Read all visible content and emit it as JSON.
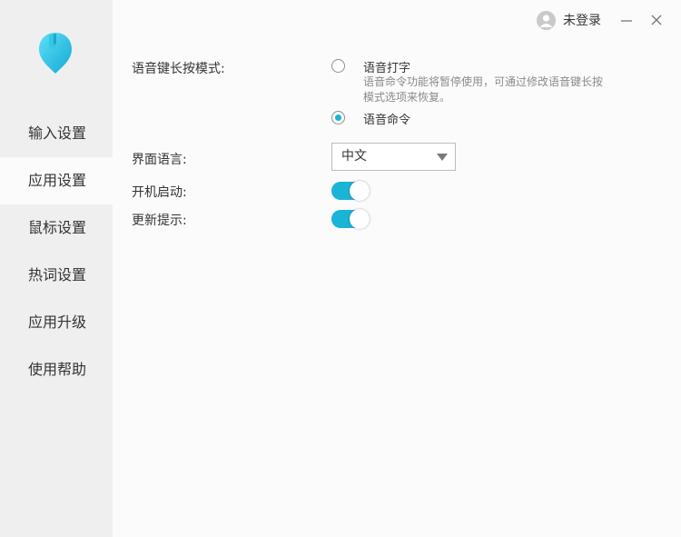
{
  "colors": {
    "accent": "#1ab4d6",
    "sidebar_bg": "#efefef",
    "content_bg": "#fbfbfb"
  },
  "titlebar": {
    "user_label": "未登录",
    "minimize_icon": "minimize-icon",
    "close_icon": "close-icon"
  },
  "sidebar": {
    "items": [
      {
        "label": "输入设置",
        "active": false
      },
      {
        "label": "应用设置",
        "active": true
      },
      {
        "label": "鼠标设置",
        "active": false
      },
      {
        "label": "热词设置",
        "active": false
      },
      {
        "label": "应用升级",
        "active": false
      },
      {
        "label": "使用帮助",
        "active": false
      }
    ]
  },
  "settings": {
    "voice_key_mode": {
      "label": "语音键长按模式:",
      "options": [
        {
          "label": "语音打字",
          "checked": false
        },
        {
          "label": "语音命令",
          "checked": true
        }
      ],
      "hint": "语音命令功能将暂停使用，可通过修改语音键长按模式选项来恢复。"
    },
    "interface_language": {
      "label": "界面语言:",
      "value": "中文"
    },
    "autostart": {
      "label": "开机启动:",
      "enabled": true
    },
    "update_notice": {
      "label": "更新提示:",
      "enabled": true
    }
  }
}
